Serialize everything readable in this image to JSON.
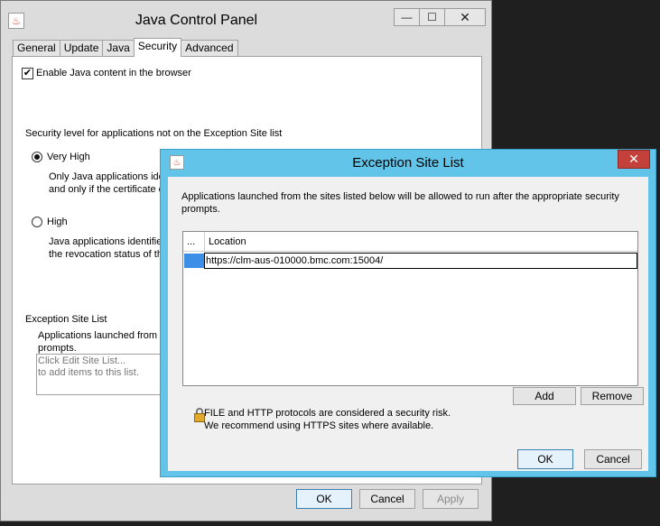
{
  "main_window": {
    "title": "Java Control Panel",
    "controls": {
      "minimize": "—",
      "maximize": "☐",
      "close": "✕"
    },
    "tabs": [
      {
        "label": "General",
        "active": false
      },
      {
        "label": "Update",
        "active": false
      },
      {
        "label": "Java",
        "active": false
      },
      {
        "label": "Security",
        "active": true
      },
      {
        "label": "Advanced",
        "active": false
      }
    ],
    "security": {
      "enable_java_label": "Enable Java content in the browser",
      "enable_java_checked": true,
      "level_heading": "Security level for applications not on the Exception Site list",
      "very_high_label": "Very High",
      "very_high_desc_1": "Only Java applications ide",
      "very_high_desc_2": "and only if the certificate c",
      "high_label": "High",
      "high_desc_1": "Java applications identified",
      "high_desc_2": "the revocation status of th",
      "exception_heading": "Exception Site List",
      "exception_desc_1": "Applications launched from t",
      "exception_desc_2": "prompts.",
      "exception_box_line_1": "Click Edit Site List...",
      "exception_box_line_2": "to add items to this list."
    },
    "footer": {
      "ok": "OK",
      "cancel": "Cancel",
      "apply": "Apply"
    }
  },
  "dialog": {
    "title": "Exception Site List",
    "close": "✕",
    "intro_line_1": "Applications launched from the sites listed below will be allowed to run after the appropriate security",
    "intro_line_2": "prompts.",
    "table": {
      "col_dots": "...",
      "col_location": "Location",
      "rows": [
        {
          "location": "https://clm-aus-010000.bmc.com:15004/"
        }
      ]
    },
    "add": "Add",
    "remove": "Remove",
    "warning_line_1": "FILE and HTTP protocols are considered a security risk.",
    "warning_line_2": "We recommend using HTTPS sites where available.",
    "ok": "OK",
    "cancel": "Cancel"
  }
}
